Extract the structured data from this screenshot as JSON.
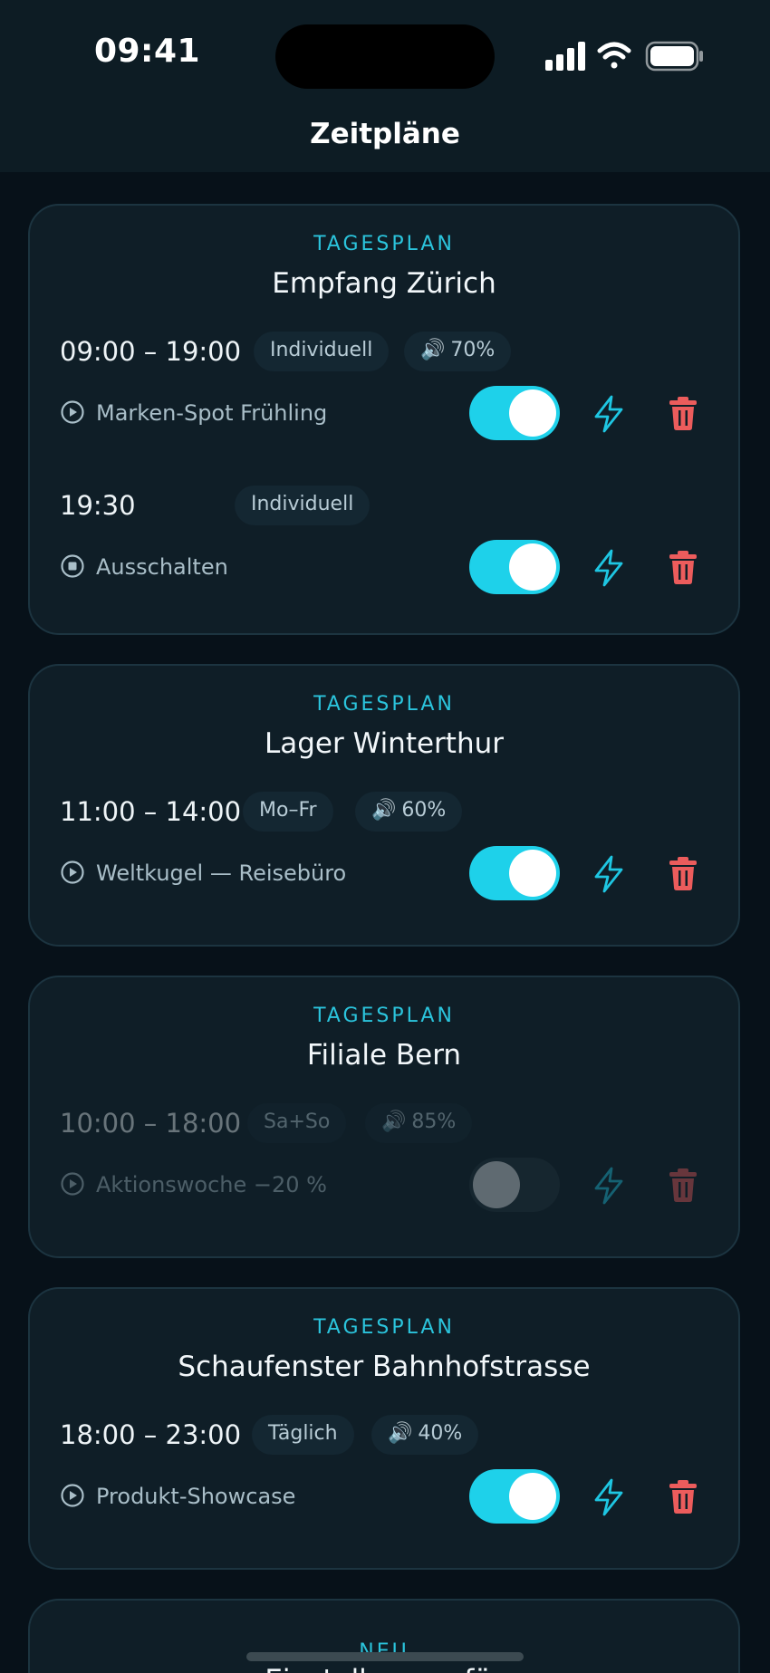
{
  "status_bar": {
    "time": "09:41"
  },
  "header": {
    "title": "Zeitpläne"
  },
  "colors": {
    "accent": "#1ed1ea",
    "danger": "#ec5c5c",
    "background": "#071119",
    "card": "#0f1e27"
  },
  "icons": {
    "play": "play-circle-icon",
    "stop": "stop-circle-icon",
    "speaker": "speaker-icon",
    "bolt": "bolt-icon",
    "trash": "trash-icon"
  },
  "cards": [
    {
      "kicker": "TAGESPLAN",
      "name": "Empfang Zürich",
      "entries": [
        {
          "range": "09:00 – 19:00",
          "days": "Individuell",
          "volume": "70%",
          "action": "Marken-Spot Frühling",
          "action_icon": "play-circle-icon",
          "enabled": true
        },
        {
          "range": "19:30",
          "days": "Individuell",
          "volume": "",
          "action": "Ausschalten",
          "action_icon": "stop-circle-icon",
          "enabled": true
        }
      ]
    },
    {
      "kicker": "TAGESPLAN",
      "name": "Lager Winterthur",
      "entries": [
        {
          "range": "11:00 – 14:00",
          "days": "Mo–Fr",
          "volume": "60%",
          "action": "Weltkugel — Reisebüro",
          "action_icon": "play-circle-icon",
          "enabled": true
        }
      ]
    },
    {
      "kicker": "TAGESPLAN",
      "name": "Filiale Bern",
      "entries": [
        {
          "range": "10:00 – 18:00",
          "days": "Sa+So",
          "volume": "85%",
          "action": "Aktionswoche −20 %",
          "action_icon": "play-circle-icon",
          "enabled": false
        }
      ]
    },
    {
      "kicker": "TAGESPLAN",
      "name": "Schaufenster Bahnhofstrasse",
      "entries": [
        {
          "range": "18:00 – 23:00",
          "days": "Täglich",
          "volume": "40%",
          "action": "Produkt-Showcase",
          "action_icon": "play-circle-icon",
          "enabled": true
        }
      ]
    },
    {
      "kicker": "NEU",
      "name": "Einstellungen für",
      "entries": []
    }
  ]
}
